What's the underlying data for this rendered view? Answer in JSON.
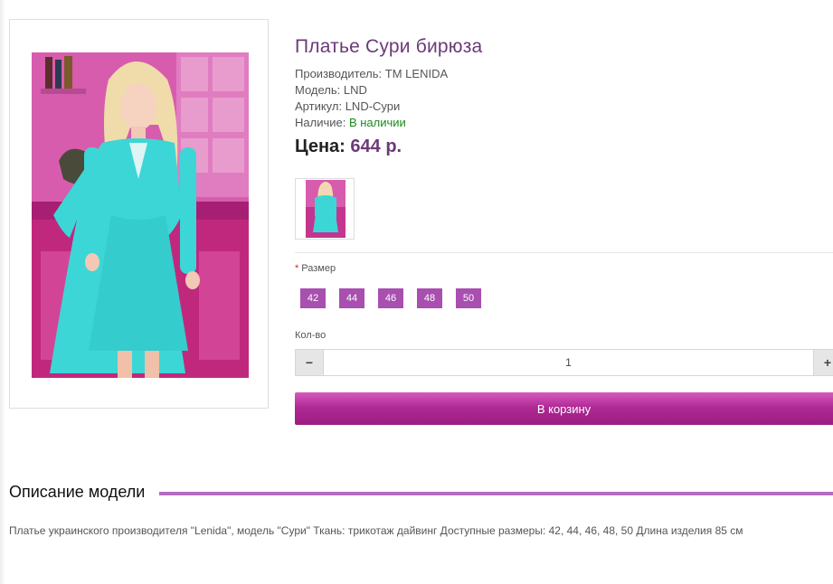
{
  "product": {
    "title": "Платье Сури бирюза",
    "manufacturer_label": "Производитель:",
    "manufacturer_value": "TM LENIDA",
    "model_label": "Модель:",
    "model_value": "LND",
    "sku_label": "Артикул:",
    "sku_value": "LND-Сури",
    "stock_label": "Наличие:",
    "stock_value": "В наличии",
    "price_label": "Цена:",
    "price_value": "644 р."
  },
  "options": {
    "size_label": "Размер",
    "required_mark": "*",
    "sizes": [
      "42",
      "44",
      "46",
      "48",
      "50"
    ]
  },
  "quantity": {
    "label": "Кол-во",
    "minus": "−",
    "value": "1",
    "plus": "+"
  },
  "cart": {
    "button_label": "В корзину"
  },
  "description": {
    "heading": "Описание модели",
    "text": "Платье украинского производителя \"Lenida\", модель \"Сури\" Ткань: трикотаж дайвинг Доступные размеры: 42, 44, 46, 48, 50 Длина изделия 85 см"
  },
  "colors": {
    "accent": "#6b3a78",
    "size_button": "#a84fb0",
    "cart_button": "#b02a96",
    "in_stock": "#1a8a1a"
  },
  "icons": {
    "product_photo": "dress-photo",
    "thumbnail": "dress-thumbnail"
  }
}
